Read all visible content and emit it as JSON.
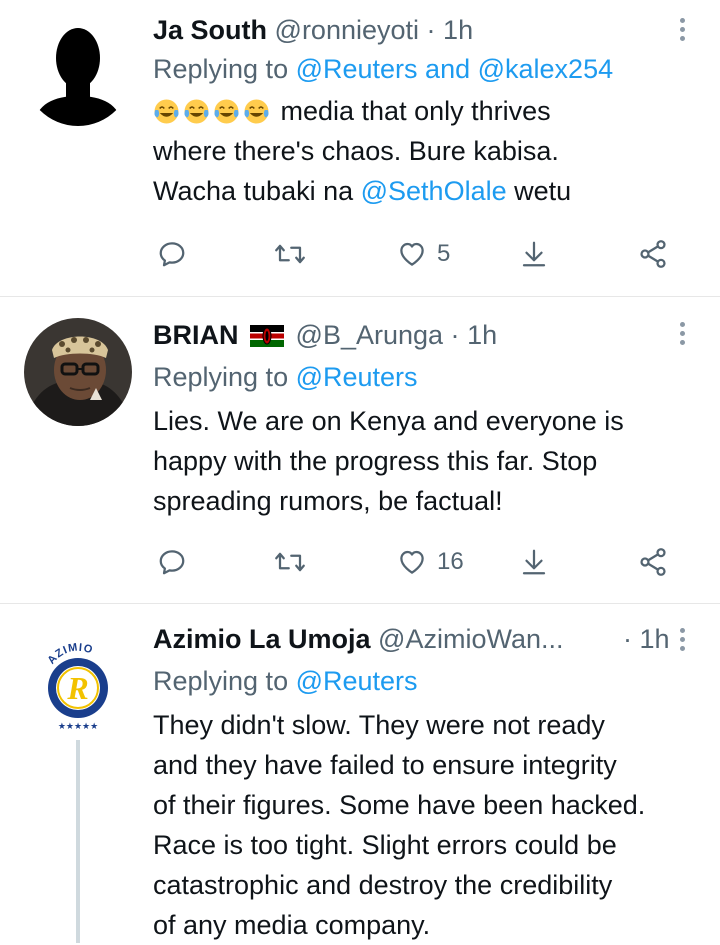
{
  "tweets": [
    {
      "name": "Ja South",
      "handle": "@ronnieyoti",
      "dot": "·",
      "time": "1h",
      "replying_prefix": "Replying to ",
      "replying_mention_1": "@Reuters",
      "replying_and": " and ",
      "replying_mention_2": "@kalex254",
      "emoji_count": 4,
      "emoji_name": "face-with-tears-of-joy",
      "text_1": " media that only thrives",
      "text_2": "where there's chaos. Bure kabisa.",
      "text_3_prefix": "Wacha tubaki na ",
      "text_3_mention": "@SethOlale",
      "text_3_suffix": " wetu",
      "like_count": "5"
    },
    {
      "name": "BRIAN",
      "flag": "kenya-flag",
      "handle": "@B_Arunga",
      "dot": "·",
      "time": "1h",
      "replying_prefix": "Replying to ",
      "replying_mention_1": "@Reuters",
      "text_1": "Lies. We are on Kenya and everyone is",
      "text_2": "happy with the progress this far. Stop",
      "text_3": "spreading rumors, be factual!",
      "like_count": "16"
    },
    {
      "name": "Azimio La Umoja",
      "handle": "@AzimioWan...",
      "dot": "·",
      "time": "1h",
      "replying_prefix": "Replying to ",
      "replying_mention_1": "@Reuters",
      "avatar_text": "AZIMIO",
      "avatar_letter": "R",
      "text_1": "They didn't slow. They were not ready",
      "text_2": "and they have failed to ensure integrity",
      "text_3": "of their figures. Some have been hacked.",
      "text_4": "Race is too tight. Slight errors could be",
      "text_5": "catastrophic and destroy the credibility",
      "text_6": "of any media company."
    }
  ],
  "icons": {
    "reply": "reply-icon",
    "retweet": "retweet-icon",
    "like": "heart-icon",
    "bookmark": "bookmark-download-icon",
    "share": "share-icon",
    "more": "more-options-icon"
  },
  "colors": {
    "link": "#1d9bf0",
    "secondary_text": "#536471",
    "primary_text": "#0f1419"
  }
}
